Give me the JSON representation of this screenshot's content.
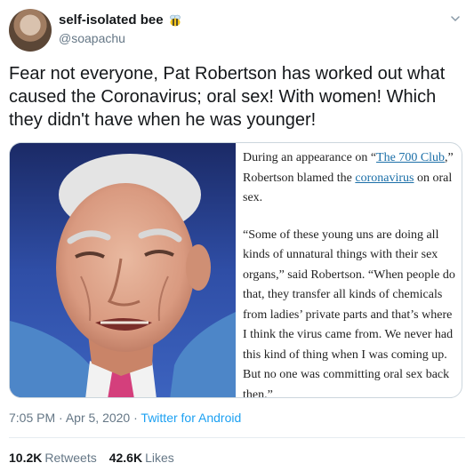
{
  "user": {
    "display_name": "self-isolated bee",
    "handle": "@soapachu",
    "name_emoji": "bee-icon"
  },
  "tweet": {
    "text": "Fear not everyone, Pat Robertson has worked out what caused the Coronavirus; oral sex! With women! Which they didn't have when he was younger!"
  },
  "article": {
    "p1_before": "During an appearance on “",
    "p1_link1": "The 700 Club",
    "p1_middle": ",” Robertson blamed the ",
    "p1_link2": "coronavirus",
    "p1_after": " on oral sex.",
    "p2": "“Some of these young uns are doing all kinds of unnatural things with their sex organs,” said Robertson. “When people do that, they transfer all kinds of chemicals from ladies’ private parts and that’s where I think the virus came from. We never had this kind of thing when I was coming up. But no one was committing oral sex back then.”"
  },
  "meta": {
    "time": "7:05 PM",
    "separator": "·",
    "date": "Apr 5, 2020",
    "source": "Twitter for Android"
  },
  "stats": {
    "retweets_count": "10.2K",
    "retweets_label": "Retweets",
    "likes_count": "42.6K",
    "likes_label": "Likes"
  },
  "colors": {
    "link": "#1da1f2",
    "secondary_text": "#657786",
    "article_link": "#1b6fa8"
  }
}
